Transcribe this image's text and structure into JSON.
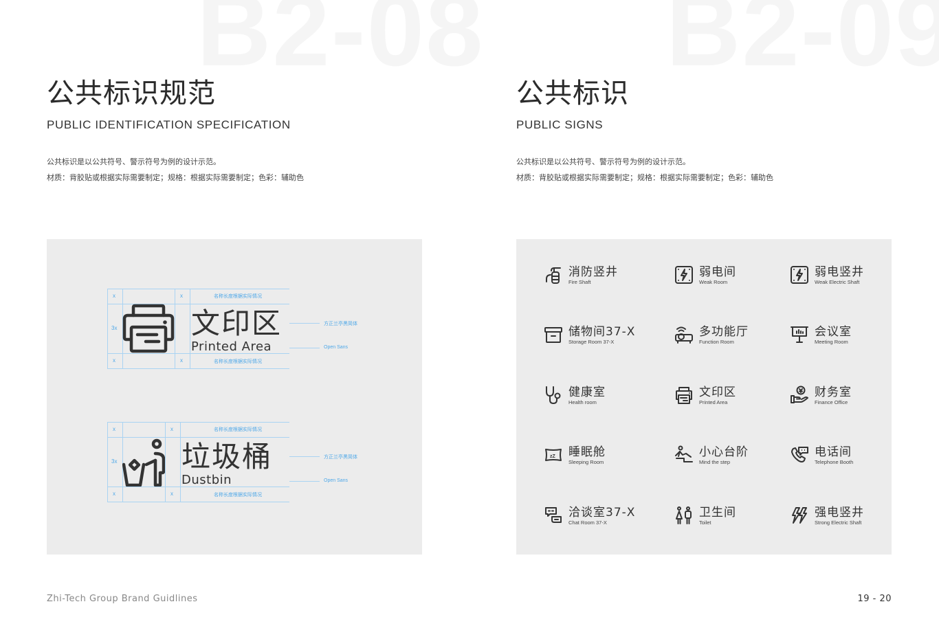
{
  "left_page": {
    "bg_code": "B2-08",
    "title_cn": "公共标识规范",
    "title_en": "PUBLIC IDENTIFICATION SPECIFICATION",
    "desc_lines": [
      "公共标识是以公共符号、警示符号为例的设计示范。",
      "材质：背胶贴或根据实际需要制定；规格：根据实际需要制定；色彩：辅助色"
    ],
    "spec_examples": [
      {
        "icon": "printer-icon",
        "name_cn": "文印区",
        "name_en": "Printed Area",
        "unit_label": "x",
        "height_label": "3x",
        "length_note": "名称长度根据实际情况",
        "font_cn_note": "方正兰亭黑简体",
        "font_en_note": "Open Sans"
      },
      {
        "icon": "dustbin-icon",
        "name_cn": "垃圾桶",
        "name_en": "Dustbin",
        "unit_label": "x",
        "height_label": "3x",
        "length_note": "名称长度根据实际情况",
        "font_cn_note": "方正兰亭黑简体",
        "font_en_note": "Open Sans"
      }
    ],
    "guide_color": "#a9d3f2",
    "note_color": "#4fa8e8"
  },
  "right_page": {
    "bg_code": "B2-09",
    "title_cn": "公共标识",
    "title_en": "PUBLIC SIGNS",
    "desc_lines": [
      "公共标识是以公共符号、警示符号为例的设计示范。",
      "材质：背胶贴或根据实际需要制定；规格：根据实际需要制定；色彩：辅助色"
    ],
    "signs": [
      {
        "icon": "fire-extinguisher-icon",
        "cn": "消防竖井",
        "en": "Fire Shaft"
      },
      {
        "icon": "weak-electric-icon",
        "cn": "弱电间",
        "en": "Weak Room"
      },
      {
        "icon": "weak-electric-icon",
        "cn": "弱电竖井",
        "en": "Weak Electric Shaft"
      },
      {
        "icon": "storage-box-icon",
        "cn": "储物间37-X",
        "en": "Storage Room 37-X"
      },
      {
        "icon": "projector-icon",
        "cn": "多功能厅",
        "en": "Function Room"
      },
      {
        "icon": "presentation-board-icon",
        "cn": "会议室",
        "en": "Meeting Room"
      },
      {
        "icon": "stethoscope-icon",
        "cn": "健康室",
        "en": "Health room"
      },
      {
        "icon": "printer-icon",
        "cn": "文印区",
        "en": "Printed Area"
      },
      {
        "icon": "money-hand-icon",
        "cn": "财务室",
        "en": "Finance Office"
      },
      {
        "icon": "sleep-pillow-icon",
        "cn": "睡眠舱",
        "en": "Sleeping Room"
      },
      {
        "icon": "step-caution-icon",
        "cn": "小心台阶",
        "en": "Mind the step"
      },
      {
        "icon": "telephone-chat-icon",
        "cn": "电话间",
        "en": "Telephone Booth"
      },
      {
        "icon": "chat-bubbles-icon",
        "cn": "洽谈室37-X",
        "en": "Chat Room 37-X"
      },
      {
        "icon": "toilet-people-icon",
        "cn": "卫生间",
        "en": "Toilet"
      },
      {
        "icon": "strong-electric-icon",
        "cn": "强电竖井",
        "en": "Strong Electric Shaft"
      }
    ]
  },
  "footer": {
    "brand": "Zhi-Tech Group Brand Guidlines",
    "pages": "19 - 20"
  },
  "colors": {
    "panel_bg": "#ececec",
    "text": "#333333",
    "bg_code": "#f5f5f5"
  }
}
